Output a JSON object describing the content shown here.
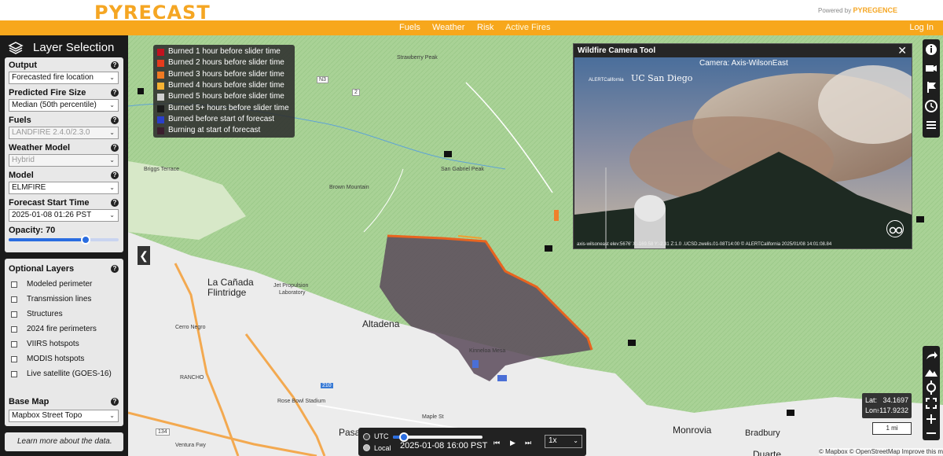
{
  "header": {
    "logo_text": "PYRECAST",
    "powered_prefix": "Powered by",
    "powered_brand": "PYREGENCE",
    "nav": [
      {
        "label": "Fuels",
        "active": false
      },
      {
        "label": "Weather",
        "active": false
      },
      {
        "label": "Risk",
        "active": false
      },
      {
        "label": "Active Fires",
        "active": true
      }
    ],
    "login_label": "Log In"
  },
  "sidebar": {
    "title": "Layer Selection",
    "fields": [
      {
        "label": "Output",
        "value": "Forecasted fire location",
        "disabled": false
      },
      {
        "label": "Predicted Fire Size",
        "value": "Median (50th percentile)",
        "disabled": false
      },
      {
        "label": "Fuels",
        "value": "LANDFIRE 2.4.0/2.3.0",
        "disabled": true
      },
      {
        "label": "Weather Model",
        "value": "Hybrid",
        "disabled": true
      },
      {
        "label": "Model",
        "value": "ELMFIRE",
        "disabled": false
      },
      {
        "label": "Forecast Start Time",
        "value": "2025-01-08 01:26 PST",
        "disabled": false
      }
    ],
    "opacity_label": "Opacity: 70",
    "opacity_value": 70,
    "optional_title": "Optional Layers",
    "optional_layers": [
      "Modeled perimeter",
      "Transmission lines",
      "Structures",
      "2024 fire perimeters",
      "VIIRS hotspots",
      "MODIS hotspots",
      "Live satellite (GOES-16)"
    ],
    "base_map_label": "Base Map",
    "base_map_value": "Mapbox Street Topo",
    "learn_more": "Learn more about the data.",
    "help_glyph": "?"
  },
  "legend": [
    {
      "label": "Burned 1 hour before slider time",
      "color": "#c1121f"
    },
    {
      "label": "Burned 2 hours before slider time",
      "color": "#e63b1d"
    },
    {
      "label": "Burned 3 hours before slider time",
      "color": "#f07a22"
    },
    {
      "label": "Burned 4 hours before slider time",
      "color": "#f6b233"
    },
    {
      "label": "Burned 5 hours before slider time",
      "color": "#cfcfcf"
    },
    {
      "label": "Burned 5+ hours before slider time",
      "color": "#1a1a1a"
    },
    {
      "label": "Burned before start of forecast",
      "color": "#2a3fc9"
    },
    {
      "label": "Burning at start of forecast",
      "color": "#3b1e2e"
    }
  ],
  "camera_tool": {
    "title": "Wildfire Camera Tool",
    "camera_label": "Camera: Axis-WilsonEast",
    "close_glyph": "✕",
    "brand_alert": "ALERTCalifornia",
    "brand_ucsd": "UC San Diego",
    "caption": "axis-wilsoneast elev:5676' X:-169.58 Y:-2.31 Z:1.0 .UCSD.zwelis.01-08T14:00 © ALERTCalifornia 2025/01/08 14:01:08.84"
  },
  "map_labels": {
    "strawberry_peak": "Strawberry Peak",
    "san_gabriel_peak": "San Gabriel Peak",
    "briggs_terrace": "Briggs Terrace",
    "brown_mountain": "Brown Mountain",
    "la_canada": "La Cañada",
    "flintridge": "Flintridge",
    "jpl": "Jet Propulsion",
    "jpl2": "Laboratory",
    "altadena": "Altadena",
    "kinneloa": "Kinneloa Mesa",
    "cerro_negro": "Cerro Negro",
    "rancho": "RANCHO",
    "rose_bowl": "Rose Bowl Stadium",
    "maple_st": "Maple St",
    "pasadena": "Pasad",
    "monrovia": "Monrovia",
    "bradbury": "Bradbury",
    "duarte": "Duarte",
    "n3": "N3",
    "r2": "2",
    "r210": "210",
    "r134": "134",
    "ventura": "Ventura Fwy"
  },
  "time_bar": {
    "utc_label": "UTC",
    "local_label": "Local",
    "selected_zone": "Local",
    "datetime": "2025-01-08 16:00 PST",
    "progress": 0.12,
    "speed": "1x",
    "skip_start": "⏮",
    "play": "▶",
    "skip_end": "⏭"
  },
  "coords": {
    "lat_label": "Lat:",
    "lat_value": "34.1697",
    "lon_label": "Lon:",
    "lon_value": "-117.9232"
  },
  "scale_label": "1 mi",
  "attribution": "© Mapbox © OpenStreetMap  Improve this map",
  "collapse_glyph": "❮"
}
